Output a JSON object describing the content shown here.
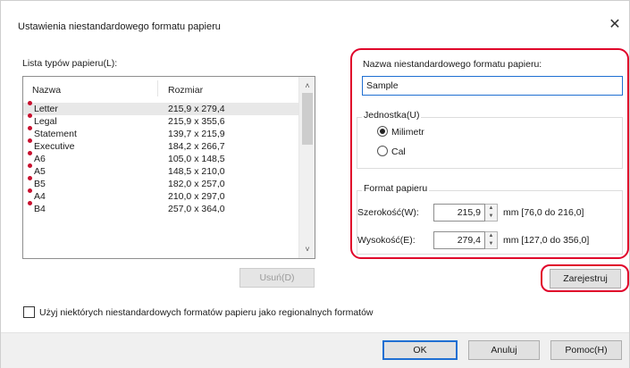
{
  "window": {
    "title": "Ustawienia niestandardowego formatu papieru",
    "close_glyph": "✕"
  },
  "paper_list": {
    "label": "Lista typów papieru(L):",
    "columns": [
      "Nazwa",
      "Rozmiar"
    ],
    "rows": [
      {
        "name": "Letter",
        "size": "215,9 x 279,4"
      },
      {
        "name": "Legal",
        "size": "215,9 x 355,6"
      },
      {
        "name": "Statement",
        "size": "139,7 x 215,9"
      },
      {
        "name": "Executive",
        "size": "184,2 x 266,7"
      },
      {
        "name": "A6",
        "size": "105,0 x 148,5"
      },
      {
        "name": "A5",
        "size": "148,5 x 210,0"
      },
      {
        "name": "B5",
        "size": "182,0 x 257,0"
      },
      {
        "name": "A4",
        "size": "210,0 x 297,0"
      },
      {
        "name": "B4",
        "size": "257,0 x 364,0"
      }
    ],
    "selected_index": 0,
    "delete_label": "Usuń(D)",
    "scroll_up_glyph": "˄",
    "scroll_down_glyph": "˅"
  },
  "custom_format": {
    "name_label": "Nazwa niestandardowego formatu papieru:",
    "name_value": "Sample",
    "unit": {
      "title": "Jednostka(U)",
      "options": [
        "Milimetr",
        "Cal"
      ],
      "selected": "Milimetr"
    },
    "paper_format": {
      "title": "Format papieru",
      "width_label": "Szerokość(W):",
      "width_value": "215,9",
      "width_range": "mm [76,0 do 216,0]",
      "height_label": "Wysokość(E):",
      "height_value": "279,4",
      "height_range": "mm [127,0 do 356,0]"
    },
    "register_label": "Zarejestruj"
  },
  "checkbox": {
    "label": "Użyj niektórych niestandardowych formatów papieru jako regionalnych formatów",
    "checked": false
  },
  "buttons": {
    "ok": "OK",
    "cancel": "Anuluj",
    "help": "Pomoc(H)"
  },
  "colors": {
    "highlight_outline": "#e0002a",
    "focus_blue": "#1f6fd2",
    "list_marker": "#c8102e"
  },
  "icons": {
    "close": "close-icon",
    "scroll_up": "scroll-up-icon",
    "scroll_down": "scroll-down-icon",
    "spin_up": "spin-up-icon",
    "spin_down": "spin-down-icon"
  }
}
